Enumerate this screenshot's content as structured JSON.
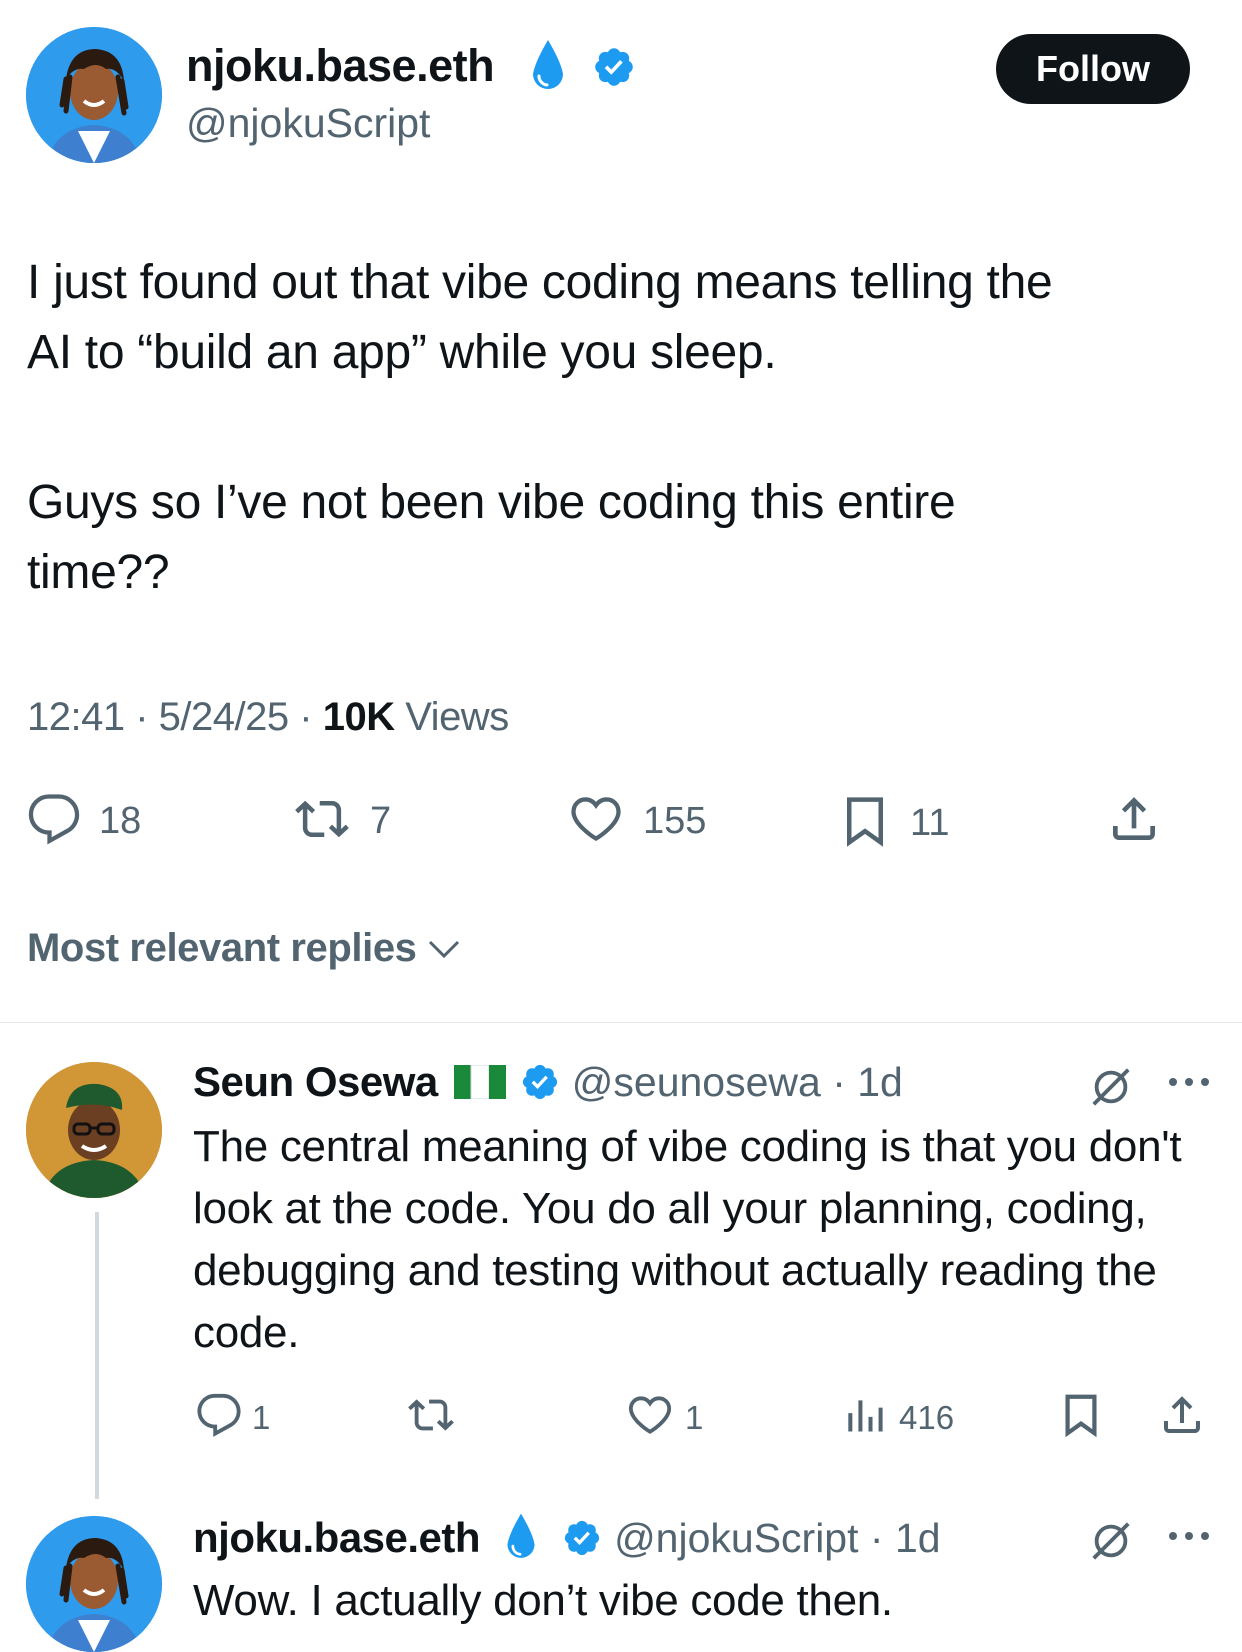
{
  "tweet": {
    "author_name": "njoku.base.eth",
    "author_handle": "@njokuScript",
    "follow_label": "Follow",
    "text_p1": "I just found out that vibe coding means telling the\nAI to “build an app” while you sleep.",
    "text_p2": "Guys so I’ve not been vibe coding this entire\ntime??",
    "time": "12:41",
    "date": "5/24/25",
    "views_count": "10K",
    "views_label": "Views",
    "replies": "18",
    "reposts": "7",
    "likes": "155",
    "bookmarks": "11"
  },
  "replies_filter": {
    "label": "Most relevant replies"
  },
  "reply1": {
    "author_name": "Seun Osewa",
    "author_handle": "@seunosewa",
    "age": "1d",
    "text": "The central meaning of vibe coding is that you don't look at the code. You do all your planning, coding, debugging and testing without actually reading the code.",
    "replies": "1",
    "likes": "1",
    "views": "416"
  },
  "reply2": {
    "author_name": "njoku.base.eth",
    "author_handle": "@njokuScript",
    "age": "1d",
    "text": "Wow. I actually don’t vibe code then."
  },
  "colors": {
    "verified": "#1d9bf0",
    "droplet": "#1d9bf0",
    "muted": "#536471",
    "text": "#0f1419"
  },
  "icons": {
    "droplet": "water-droplet-icon",
    "verified": "verified-badge-icon",
    "flag": "nigeria-flag-icon",
    "grok": "grok-icon",
    "more": "more-icon"
  }
}
